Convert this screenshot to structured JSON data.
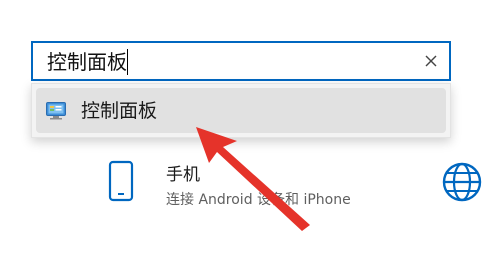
{
  "search": {
    "query": "控制面板",
    "clear_icon": "close-icon"
  },
  "suggestions": [
    {
      "label": "控制面板",
      "icon": "control-panel-icon"
    }
  ],
  "settings_tile": {
    "title": "手机",
    "subtitle": "连接 Android 设备和 iPhone",
    "icon": "phone-icon"
  },
  "side_icon": "globe-icon",
  "annotation": {
    "icon": "red-arrow",
    "color": "#e5332a"
  },
  "colors": {
    "accent": "#0067c0",
    "annotation": "#e5332a"
  }
}
